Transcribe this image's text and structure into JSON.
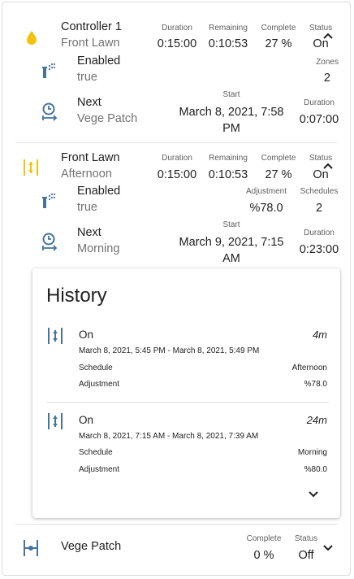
{
  "colors": {
    "accent": "#f4c20d",
    "icon_blue": "#44739e"
  },
  "controller": {
    "icon": "water-drop-icon",
    "name": "Controller 1",
    "zone_name": "Front Lawn",
    "duration_label": "Duration",
    "duration": "0:15:00",
    "remaining_label": "Remaining",
    "remaining": "0:10:53",
    "complete_label": "Complete",
    "complete": "27 %",
    "status_label": "Status",
    "status": "On",
    "enabled_icon": "sprinkler-icon",
    "enabled_label": "Enabled",
    "enabled": "true",
    "zones_label": "Zones",
    "zones": "2",
    "next_icon": "clock-arrow-icon",
    "next_label": "Next",
    "next": "Vege Patch",
    "start_label": "Start",
    "start": "March 8, 2021, 7:58 PM",
    "next_duration_label": "Duration",
    "next_duration": "0:07:00"
  },
  "zone1": {
    "icon": "valve-open-icon",
    "name": "Front Lawn",
    "schedule": "Afternoon",
    "duration_label": "Duration",
    "duration": "0:15:00",
    "remaining_label": "Remaining",
    "remaining": "0:10:53",
    "complete_label": "Complete",
    "complete": "27 %",
    "status_label": "Status",
    "status": "On",
    "enabled_icon": "sprinkler-icon",
    "enabled_label": "Enabled",
    "enabled": "true",
    "adjustment_label": "Adjustment",
    "adjustment": "%78.0",
    "schedules_label": "Schedules",
    "schedules": "2",
    "next_icon": "clock-arrow-icon",
    "next_label": "Next",
    "next": "Morning",
    "start_label": "Start",
    "start": "March 9, 2021, 7:15 AM",
    "next_duration_label": "Duration",
    "next_duration": "0:23:00"
  },
  "history": {
    "title": "History",
    "entries": [
      {
        "icon": "valve-icon",
        "state": "On",
        "duration": "4m",
        "range": "March 8, 2021, 5:45 PM - March 8, 2021, 5:49 PM",
        "schedule_label": "Schedule",
        "schedule": "Afternoon",
        "adjustment_label": "Adjustment",
        "adjustment": "%78.0"
      },
      {
        "icon": "valve-icon",
        "state": "On",
        "duration": "24m",
        "range": "March 8, 2021, 7:15 AM - March 8, 2021, 7:39 AM",
        "schedule_label": "Schedule",
        "schedule": "Morning",
        "adjustment_label": "Adjustment",
        "adjustment": "%80.0"
      }
    ]
  },
  "zone2": {
    "icon": "valve-closed-icon",
    "name": "Vege Patch",
    "complete_label": "Complete",
    "complete": "0 %",
    "status_label": "Status",
    "status": "Off"
  }
}
